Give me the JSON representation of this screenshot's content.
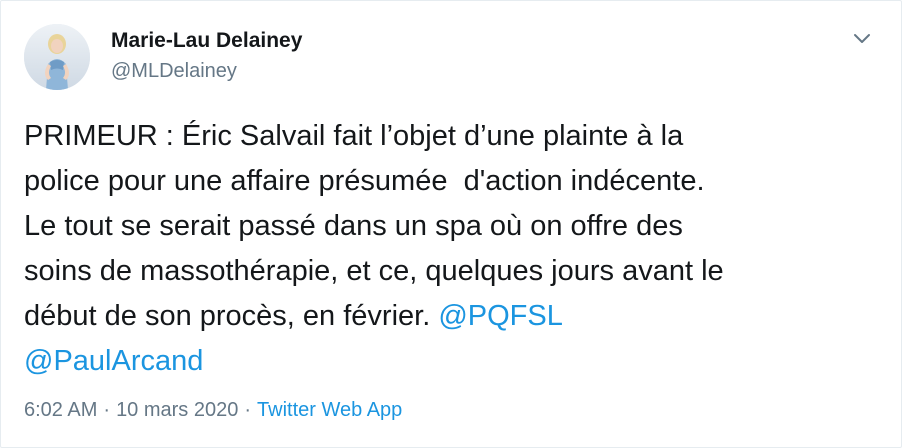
{
  "author": {
    "display_name": "Marie-Lau Delainey",
    "handle": "@MLDelainey",
    "avatar_icon": "profile-photo"
  },
  "caret_icon": "chevron-down-icon",
  "tweet": {
    "text": "PRIMEUR : Éric Salvail fait l’objet d’une plainte à la\npolice pour une affaire présumée  d'action indécente.\nLe tout se serait passé dans un spa où on offre des\nsoins de massothérapie, et ce, quelques jours avant le\ndébut de son procès, en février. ",
    "mentions": [
      "@PQFSL",
      "@PaulArcand"
    ]
  },
  "meta": {
    "time": "6:02 AM",
    "separator": "·",
    "date": "10 mars 2020",
    "source": "Twitter Web App"
  },
  "colors": {
    "text": "#14171a",
    "secondary": "#657786",
    "link": "#1b95e0",
    "border": "#e6ecf0"
  }
}
